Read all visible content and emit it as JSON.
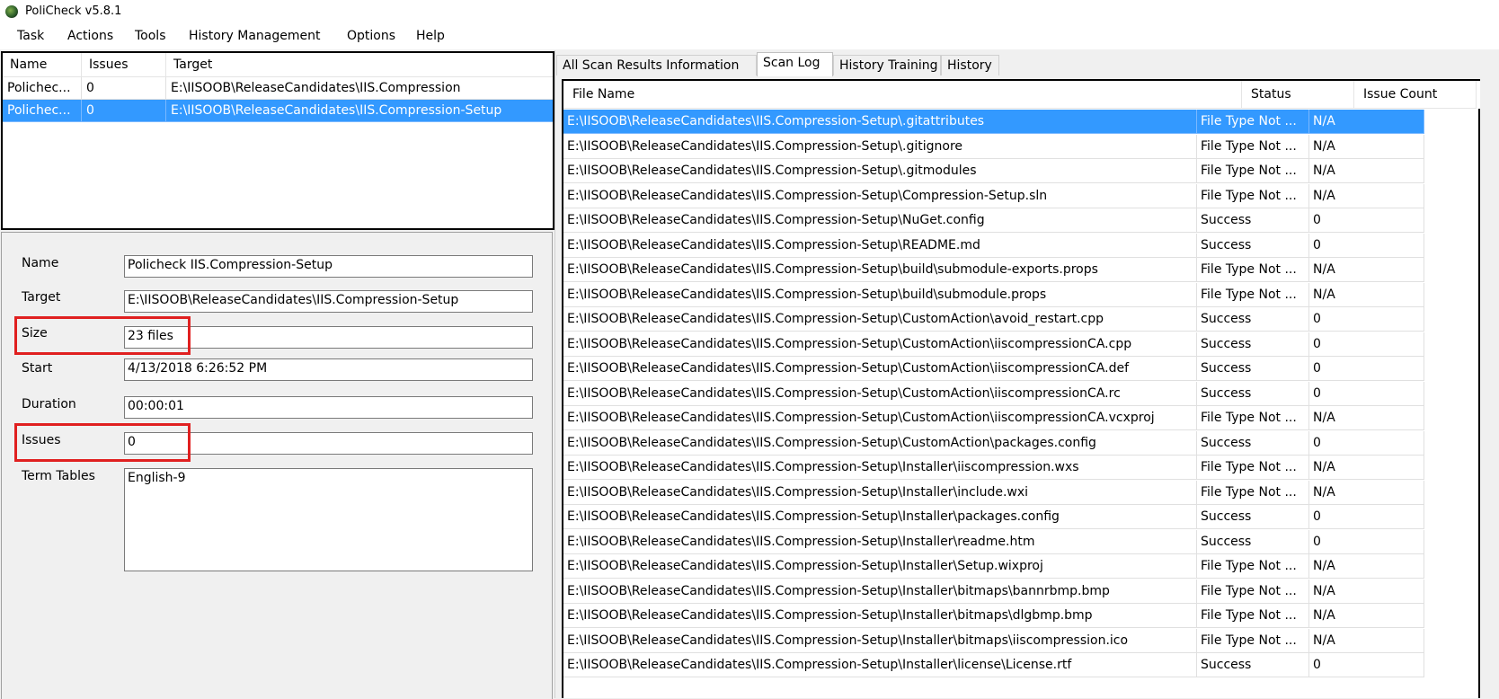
{
  "window": {
    "title": "PoliCheck v5.8.1"
  },
  "menu": [
    "Task",
    "Actions",
    "Tools",
    "History Management",
    "Options",
    "Help"
  ],
  "scans": {
    "columns": [
      "Name",
      "Issues",
      "Target"
    ],
    "rows": [
      {
        "name": "Polichec...",
        "issues": "0",
        "target": "E:\\IISOOB\\ReleaseCandidates\\IIS.Compression",
        "selected": false
      },
      {
        "name": "Polichec...",
        "issues": "0",
        "target": "E:\\IISOOB\\ReleaseCandidates\\IIS.Compression-Setup",
        "selected": true
      }
    ]
  },
  "details": {
    "name_label": "Name",
    "name_value": "Policheck IIS.Compression-Setup",
    "target_label": "Target",
    "target_value": "E:\\IISOOB\\ReleaseCandidates\\IIS.Compression-Setup",
    "size_label": "Size",
    "size_value": "23 files",
    "start_label": "Start",
    "start_value": "4/13/2018 6:26:52 PM",
    "duration_label": "Duration",
    "duration_value": "00:00:01",
    "issues_label": "Issues",
    "issues_value": "0",
    "term_tables_label": "Term Tables",
    "term_tables_value": "English-9"
  },
  "tabs": [
    {
      "label": "All Scan Results Information",
      "active": false
    },
    {
      "label": "Scan Log",
      "active": true
    },
    {
      "label": "History Training",
      "active": false
    },
    {
      "label": "History",
      "active": false
    }
  ],
  "scan_log": {
    "columns": [
      "File Name",
      "Status",
      "Issue Count"
    ],
    "rows": [
      [
        "E:\\IISOOB\\ReleaseCandidates\\IIS.Compression-Setup\\.gitattributes",
        "File Type Not ...",
        "N/A"
      ],
      [
        "E:\\IISOOB\\ReleaseCandidates\\IIS.Compression-Setup\\.gitignore",
        "File Type Not ...",
        "N/A"
      ],
      [
        "E:\\IISOOB\\ReleaseCandidates\\IIS.Compression-Setup\\.gitmodules",
        "File Type Not ...",
        "N/A"
      ],
      [
        "E:\\IISOOB\\ReleaseCandidates\\IIS.Compression-Setup\\Compression-Setup.sln",
        "File Type Not ...",
        "N/A"
      ],
      [
        "E:\\IISOOB\\ReleaseCandidates\\IIS.Compression-Setup\\NuGet.config",
        "Success",
        "0"
      ],
      [
        "E:\\IISOOB\\ReleaseCandidates\\IIS.Compression-Setup\\README.md",
        "Success",
        "0"
      ],
      [
        "E:\\IISOOB\\ReleaseCandidates\\IIS.Compression-Setup\\build\\submodule-exports.props",
        "File Type Not ...",
        "N/A"
      ],
      [
        "E:\\IISOOB\\ReleaseCandidates\\IIS.Compression-Setup\\build\\submodule.props",
        "File Type Not ...",
        "N/A"
      ],
      [
        "E:\\IISOOB\\ReleaseCandidates\\IIS.Compression-Setup\\CustomAction\\avoid_restart.cpp",
        "Success",
        "0"
      ],
      [
        "E:\\IISOOB\\ReleaseCandidates\\IIS.Compression-Setup\\CustomAction\\iiscompressionCA.cpp",
        "Success",
        "0"
      ],
      [
        "E:\\IISOOB\\ReleaseCandidates\\IIS.Compression-Setup\\CustomAction\\iiscompressionCA.def",
        "Success",
        "0"
      ],
      [
        "E:\\IISOOB\\ReleaseCandidates\\IIS.Compression-Setup\\CustomAction\\iiscompressionCA.rc",
        "Success",
        "0"
      ],
      [
        "E:\\IISOOB\\ReleaseCandidates\\IIS.Compression-Setup\\CustomAction\\iiscompressionCA.vcxproj",
        "File Type Not ...",
        "N/A"
      ],
      [
        "E:\\IISOOB\\ReleaseCandidates\\IIS.Compression-Setup\\CustomAction\\packages.config",
        "Success",
        "0"
      ],
      [
        "E:\\IISOOB\\ReleaseCandidates\\IIS.Compression-Setup\\Installer\\iiscompression.wxs",
        "File Type Not ...",
        "N/A"
      ],
      [
        "E:\\IISOOB\\ReleaseCandidates\\IIS.Compression-Setup\\Installer\\include.wxi",
        "File Type Not ...",
        "N/A"
      ],
      [
        "E:\\IISOOB\\ReleaseCandidates\\IIS.Compression-Setup\\Installer\\packages.config",
        "Success",
        "0"
      ],
      [
        "E:\\IISOOB\\ReleaseCandidates\\IIS.Compression-Setup\\Installer\\readme.htm",
        "Success",
        "0"
      ],
      [
        "E:\\IISOOB\\ReleaseCandidates\\IIS.Compression-Setup\\Installer\\Setup.wixproj",
        "File Type Not ...",
        "N/A"
      ],
      [
        "E:\\IISOOB\\ReleaseCandidates\\IIS.Compression-Setup\\Installer\\bitmaps\\bannrbmp.bmp",
        "File Type Not ...",
        "N/A"
      ],
      [
        "E:\\IISOOB\\ReleaseCandidates\\IIS.Compression-Setup\\Installer\\bitmaps\\dlgbmp.bmp",
        "File Type Not ...",
        "N/A"
      ],
      [
        "E:\\IISOOB\\ReleaseCandidates\\IIS.Compression-Setup\\Installer\\bitmaps\\iiscompression.ico",
        "File Type Not ...",
        "N/A"
      ],
      [
        "E:\\IISOOB\\ReleaseCandidates\\IIS.Compression-Setup\\Installer\\license\\License.rtf",
        "Success",
        "0"
      ]
    ],
    "selected_row": 0
  },
  "colors": {
    "selection": "#3399ff",
    "highlight_box": "#e02020"
  }
}
